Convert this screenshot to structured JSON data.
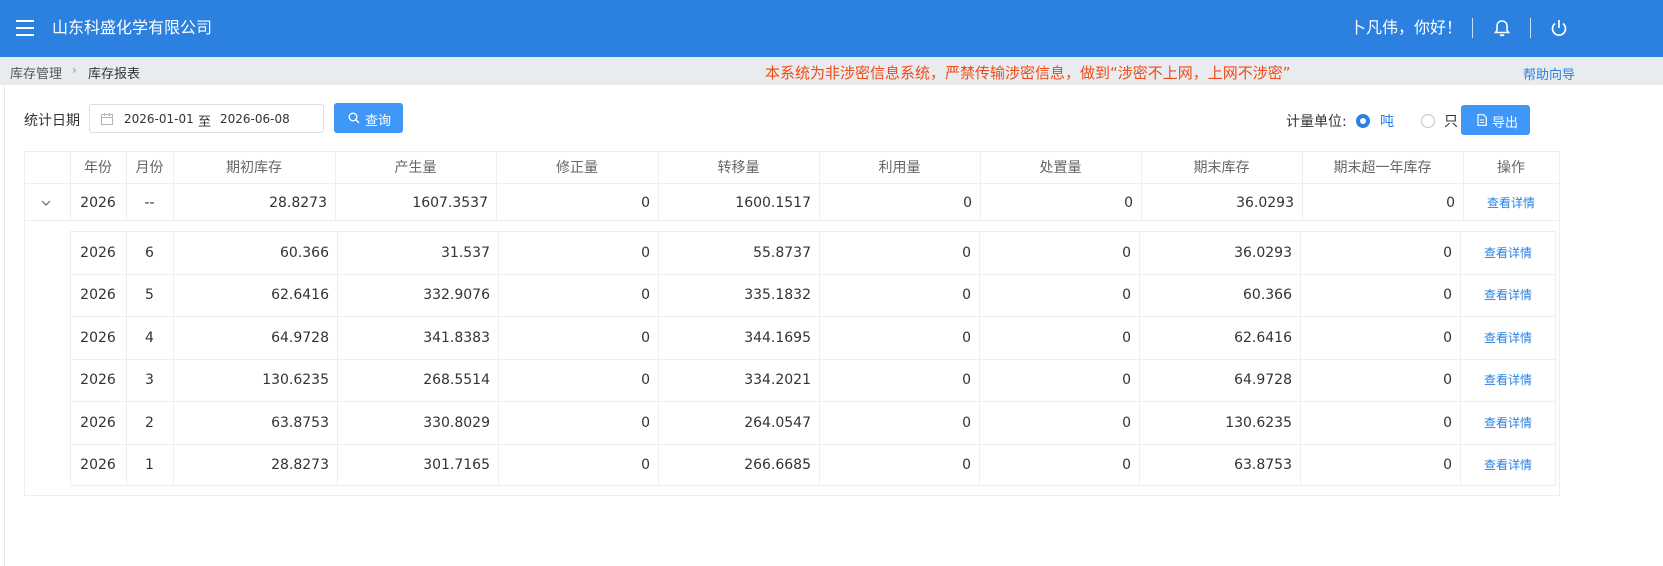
{
  "header": {
    "company": "山东科盛化学有限公司",
    "greeting": "卜凡伟，你好！",
    "icons": [
      "menu-icon",
      "bell-icon",
      "power-icon"
    ]
  },
  "breadcrumb": {
    "items": [
      "库存管理",
      "库存报表"
    ],
    "notice": "本系统为非涉密信息系统，严禁传输涉密信息，做到“涉密不上网，上网不涉密”",
    "help": "帮助向导"
  },
  "filter": {
    "date_label": "统计日期",
    "date_start": "2026-01-01",
    "date_to": "至",
    "date_end": "2026-06-08",
    "query_label": "查询",
    "unit_label": "计量单位:",
    "unit_options": [
      "吨",
      "只"
    ],
    "unit_selected": "吨",
    "export_label": "导出"
  },
  "table": {
    "columns": [
      "年份",
      "月份",
      "期初库存",
      "产生量",
      "修正量",
      "转移量",
      "利用量",
      "处置量",
      "期末库存",
      "期末超一年库存",
      "操作"
    ],
    "summary": {
      "year": "2026",
      "month": "--",
      "values": [
        "28.8273",
        "1607.3537",
        "0",
        "1600.1517",
        "0",
        "0",
        "36.0293",
        "0"
      ],
      "action": "查看详情"
    },
    "detail_rows": [
      {
        "year": "2026",
        "month": "6",
        "values": [
          "60.366",
          "31.537",
          "0",
          "55.8737",
          "0",
          "0",
          "36.0293",
          "0"
        ],
        "action": "查看详情"
      },
      {
        "year": "2026",
        "month": "5",
        "values": [
          "62.6416",
          "332.9076",
          "0",
          "335.1832",
          "0",
          "0",
          "60.366",
          "0"
        ],
        "action": "查看详情"
      },
      {
        "year": "2026",
        "month": "4",
        "values": [
          "64.9728",
          "341.8383",
          "0",
          "344.1695",
          "0",
          "0",
          "62.6416",
          "0"
        ],
        "action": "查看详情"
      },
      {
        "year": "2026",
        "month": "3",
        "values": [
          "130.6235",
          "268.5514",
          "0",
          "334.2021",
          "0",
          "0",
          "64.9728",
          "0"
        ],
        "action": "查看详情"
      },
      {
        "year": "2026",
        "month": "2",
        "values": [
          "63.8753",
          "330.8029",
          "0",
          "264.0547",
          "0",
          "0",
          "130.6235",
          "0"
        ],
        "action": "查看详情"
      },
      {
        "year": "2026",
        "month": "1",
        "values": [
          "28.8273",
          "301.7165",
          "0",
          "266.6685",
          "0",
          "0",
          "63.8753",
          "0"
        ],
        "action": "查看详情"
      }
    ]
  },
  "colors": {
    "header_bg": "#2b80e0",
    "button_bg": "#3f97f7",
    "notice": "#f04a1a",
    "link": "#2b80e0"
  }
}
